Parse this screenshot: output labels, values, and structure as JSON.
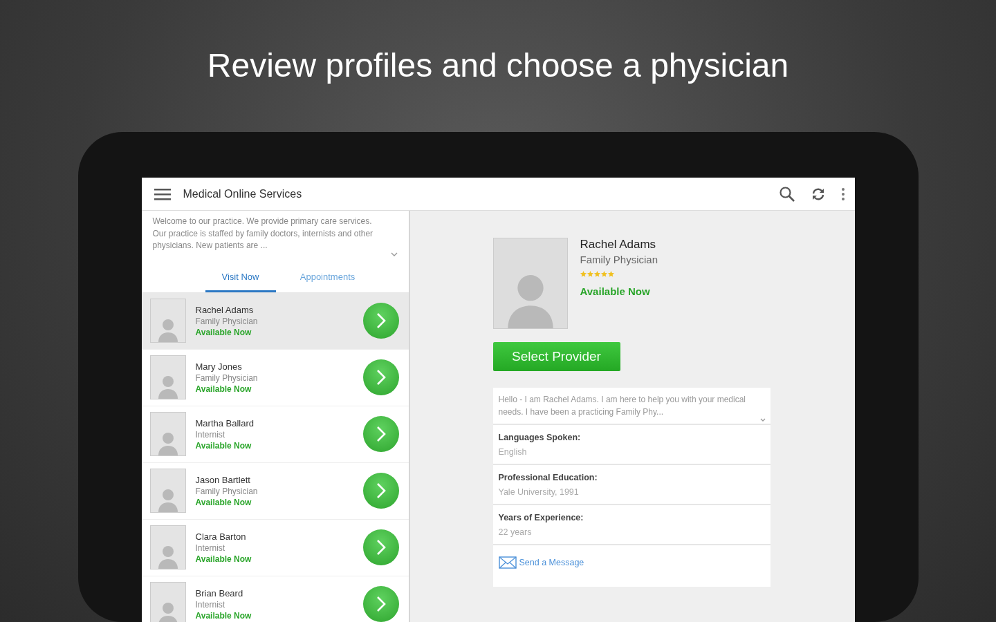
{
  "headline": "Review profiles and choose a physician",
  "app_bar": {
    "title": "Medical Online Services"
  },
  "practice_description": "Welcome to our practice. We provide primary care services. Our practice is staffed by family doctors, internists and other physicians. New patients are ...",
  "tabs": [
    {
      "label": "Visit Now",
      "selected": true
    },
    {
      "label": "Appointments",
      "selected": false
    }
  ],
  "providers": [
    {
      "name": "Rachel Adams",
      "specialty": "Family Physician",
      "availability": "Available Now",
      "selected": true
    },
    {
      "name": "Mary Jones",
      "specialty": "Family Physician",
      "availability": "Available Now",
      "selected": false
    },
    {
      "name": "Martha Ballard",
      "specialty": "Internist",
      "availability": "Available Now",
      "selected": false
    },
    {
      "name": "Jason Bartlett",
      "specialty": "Family Physician",
      "availability": "Available Now",
      "selected": false
    },
    {
      "name": "Clara Barton",
      "specialty": "Internist",
      "availability": "Available Now",
      "selected": false
    },
    {
      "name": "Brian Beard",
      "specialty": "Internist",
      "availability": "Available Now",
      "selected": false
    }
  ],
  "detail": {
    "name": "Rachel Adams",
    "specialty": "Family Physician",
    "stars": 5,
    "availability": "Available Now",
    "button": "Select Provider",
    "bio": "Hello - I am Rachel Adams. I am here to help you with your medical needs. I have been a practicing Family Phy...",
    "fields": [
      {
        "label": "Languages Spoken:",
        "value": "English"
      },
      {
        "label": "Professional Education:",
        "value": "Yale University, 1991"
      },
      {
        "label": "Years of Experience:",
        "value": "22 years"
      }
    ],
    "message_link": "Send a Message"
  }
}
